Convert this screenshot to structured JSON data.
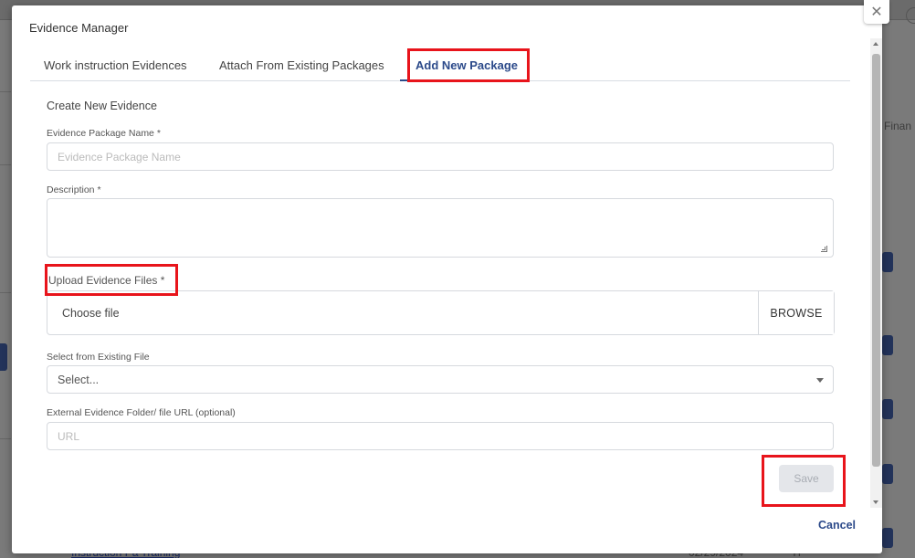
{
  "background": {
    "right_text": "Finan",
    "bottom_link": "Instruction Pa Training",
    "bottom_date": "02/29/2024",
    "bottom_extra": "Yr"
  },
  "modal": {
    "title": "Evidence Manager",
    "close_glyph": "✕",
    "tabs": [
      {
        "label": "Work instruction Evidences",
        "active": false
      },
      {
        "label": "Attach From Existing Packages",
        "active": false
      },
      {
        "label": "Add New Package",
        "active": true
      }
    ],
    "section_title": "Create New Evidence",
    "package_name": {
      "label": "Evidence Package Name *",
      "placeholder": "Evidence Package Name",
      "value": ""
    },
    "description": {
      "label": "Description *",
      "value": ""
    },
    "upload": {
      "label": "Upload Evidence Files *",
      "file_text": "Choose file",
      "browse_label": "BROWSE"
    },
    "existing_file": {
      "label": "Select from Existing File",
      "selected": "Select..."
    },
    "external_url": {
      "label": "External Evidence Folder/ file URL (optional)",
      "placeholder": "URL",
      "value": ""
    },
    "save_label": "Save",
    "cancel_label": "Cancel"
  },
  "colors": {
    "accent": "#2c4a8a",
    "annotation": "#e8141b",
    "disabled_button": "#e4e6ea"
  }
}
